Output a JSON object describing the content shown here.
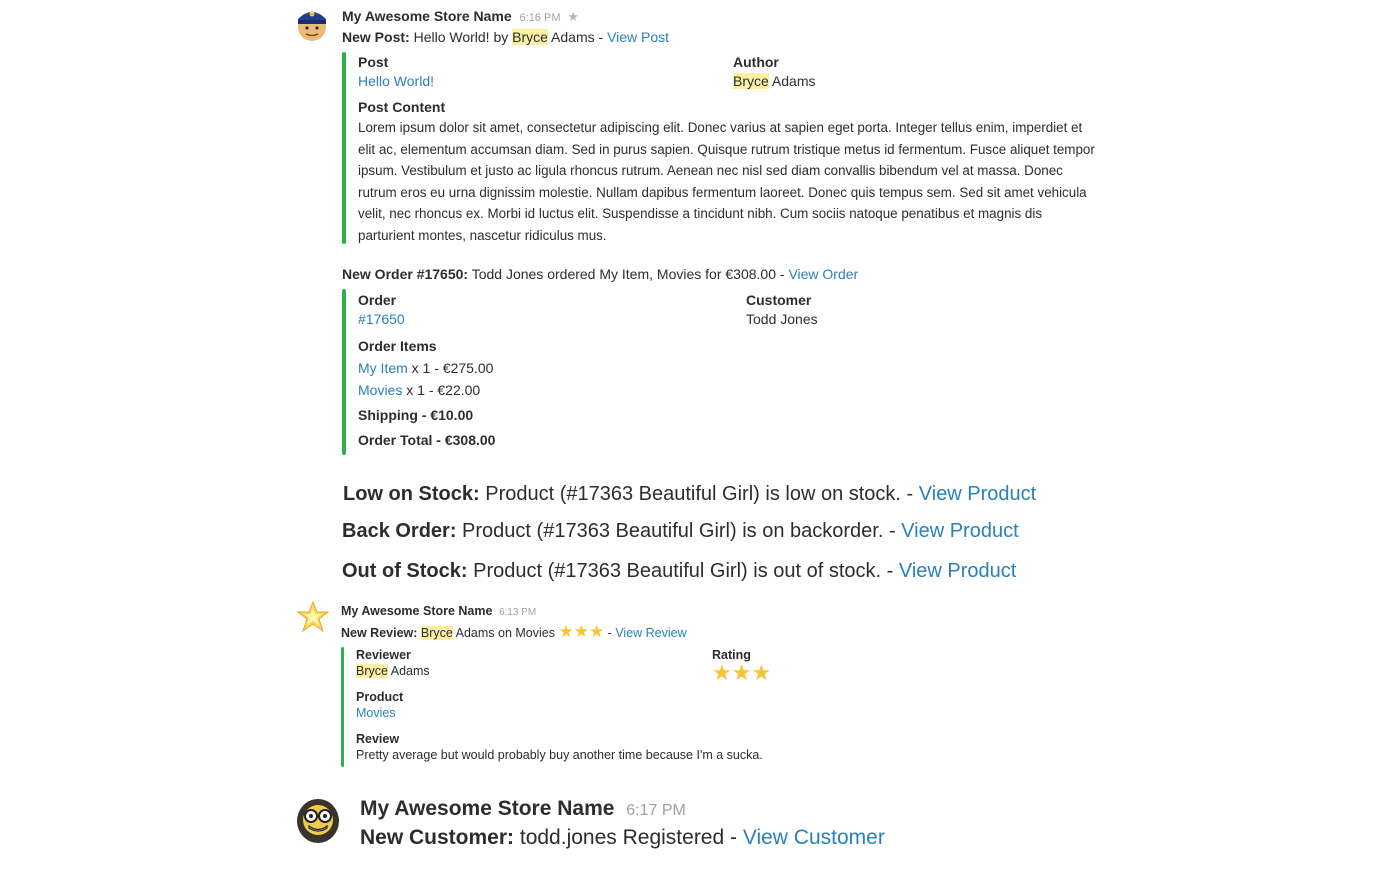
{
  "msg1": {
    "name": "My Awesome Store Name",
    "time": "6:16 PM",
    "line": {
      "label": "New Post:",
      "text_a": " Hello World! by ",
      "hl": "Bryce",
      "text_b": " Adams - ",
      "link": "View Post"
    },
    "fields": {
      "post_label": "Post",
      "post_value": "Hello World!",
      "author_label": "Author",
      "author_hl": "Bryce",
      "author_rest": " Adams",
      "content_label": "Post Content",
      "content": "Lorem ipsum dolor sit amet, consectetur adipiscing elit. Donec varius at sapien eget porta. Integer tellus enim, imperdiet et elit ac, elementum accumsan diam. Sed in purus sapien. Quisque rutrum tristique metus id fermentum. Fusce aliquet tempor ipsum. Vestibulum et justo ac ligula rhoncus rutrum. Aenean nec nisl sed diam convallis bibendum vel at massa. Donec rutrum eros eu urna dignissim molestie. Nullam dapibus fermentum laoreet. Donec quis tempus sem. Sed sit amet vehicula velit, nec rhoncus ex. Morbi id luctus elit. Suspendisse a tincidunt nibh. Cum sociis natoque penatibus et magnis dis parturient montes, nascetur ridiculus mus."
    }
  },
  "order": {
    "label": "New Order #17650:",
    "text": " Todd Jones ordered My Item, Movies for €308.00 - ",
    "link": "View Order",
    "order_label": "Order",
    "order_value": "#17650",
    "customer_label": "Customer",
    "customer_value": "Todd Jones",
    "items_label": "Order Items",
    "item1_link": "My Item",
    "item1_rest": " x 1 - €275.00",
    "item2_link": "Movies",
    "item2_rest": " x 1 - €22.00",
    "shipping": "Shipping - €10.00",
    "total": "Order Total - €308.00"
  },
  "stock": {
    "low_label": "Low on Stock:",
    "low_text": " Product (#17363 Beautiful Girl) is low on stock. - ",
    "low_link": "View Product",
    "back_label": "Back Order:",
    "back_text": " Product (#17363 Beautiful Girl) is on backorder. - ",
    "back_link": "View Product",
    "out_label": "Out of Stock:",
    "out_text": " Product (#17363 Beautiful Girl) is out of stock. - ",
    "out_link": "View Product"
  },
  "review": {
    "name": "My Awesome Store Name",
    "time": "6:13 PM",
    "label": "New Review:",
    "hl": "Bryce",
    "text": " Adams on Movies ",
    "link": "View Review",
    "link_sep": " - ",
    "rating_value": 3,
    "reviewer_label": "Reviewer",
    "reviewer_hl": "Bryce",
    "reviewer_rest": " Adams",
    "rating_label": "Rating",
    "product_label": "Product",
    "product_value": "Movies",
    "review_label": "Review",
    "review_text": "Pretty average but would probably buy another time because I'm a sucka."
  },
  "customer": {
    "name": "My Awesome Store Name",
    "time": "6:17 PM",
    "label": "New Customer:",
    "text": " todd.jones Registered - ",
    "link": "View Customer"
  },
  "icons": {
    "avatar1": "police-officer-emoji",
    "avatar2": "sparkle-star-emoji",
    "avatar3": "nerd-face-emoji",
    "star": "star-icon",
    "favorite": "star-outline-icon"
  },
  "colors": {
    "link": "#2a80b9",
    "bar": "#2fb14a",
    "highlight": "#fcefa1",
    "timestamp": "#9ea0a4"
  }
}
